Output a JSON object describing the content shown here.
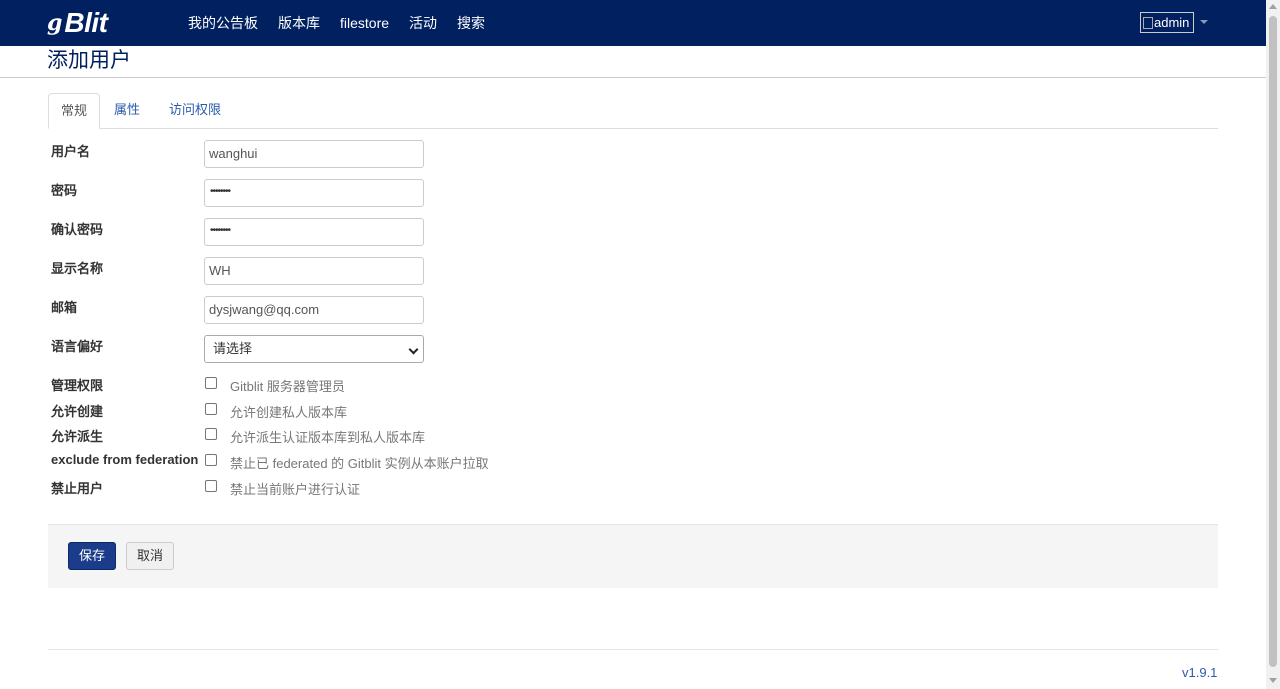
{
  "nav": {
    "brand_mark": "g",
    "brand_text": "Blit",
    "links": [
      "我的公告板",
      "版本库",
      "filestore",
      "活动",
      "搜索"
    ],
    "user": "admin"
  },
  "page": {
    "title": "添加用户"
  },
  "tabs": [
    {
      "label": "常规",
      "active": true
    },
    {
      "label": "属性",
      "active": false
    },
    {
      "label": "访问权限",
      "active": false
    }
  ],
  "form": {
    "username": {
      "label": "用户名",
      "value": "wanghui"
    },
    "password": {
      "label": "密码",
      "value": "••••••••"
    },
    "confirm_password": {
      "label": "确认密码",
      "value": "••••••••"
    },
    "display_name": {
      "label": "显示名称",
      "value": "WH"
    },
    "email": {
      "label": "邮箱",
      "value": "dysjwang@qq.com"
    },
    "language": {
      "label": "语言偏好",
      "value": "请选择"
    },
    "checkboxes": [
      {
        "label": "管理权限",
        "text": "Gitblit 服务器管理员",
        "checked": false
      },
      {
        "label": "允许创建",
        "text": "允许创建私人版本库",
        "checked": false
      },
      {
        "label": "允许派生",
        "text": "允许派生认证版本库到私人版本库",
        "checked": false
      },
      {
        "label": "exclude from federation",
        "text": "禁止已 federated 的 Gitblit 实例从本账户拉取",
        "checked": false
      },
      {
        "label": "禁止用户",
        "text": "禁止当前账户进行认证",
        "checked": false
      }
    ]
  },
  "actions": {
    "save_label": "保存",
    "cancel_label": "取消"
  },
  "footer": {
    "version": "v1.9.1"
  },
  "colors": {
    "navbar": "#002060",
    "primary_button": "#1a3c8a",
    "link": "#2a5caa"
  }
}
